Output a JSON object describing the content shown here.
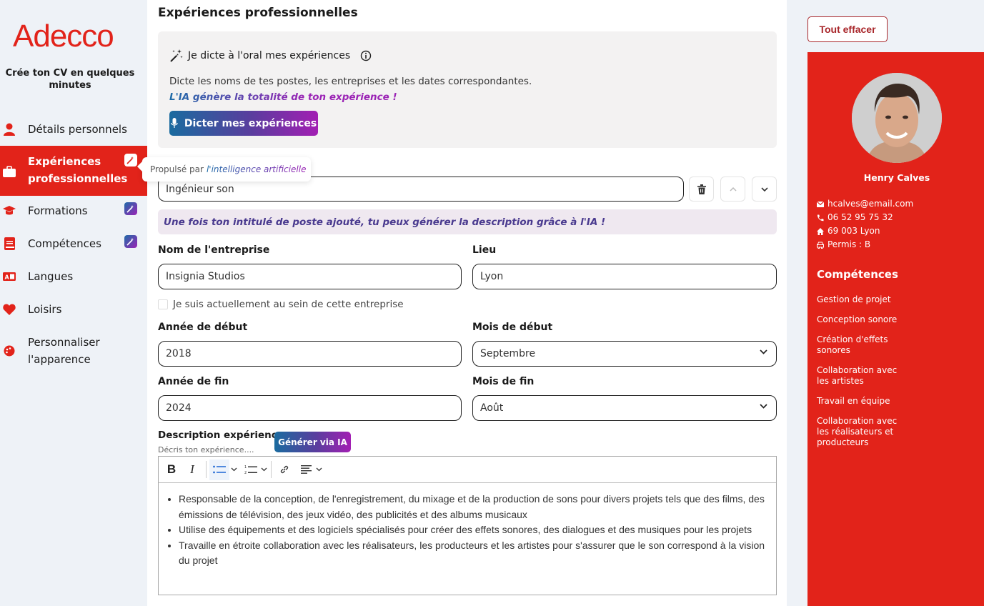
{
  "brand": {
    "logo": "Adecco",
    "tagline": "Crée ton CV en quelques minutes",
    "accent": "#e2231a"
  },
  "sidebar": {
    "items": [
      {
        "label": "Détails personnels",
        "icon": "user-icon",
        "ai": false,
        "active": false
      },
      {
        "label": "Expériences professionnelles",
        "icon": "briefcase-icon",
        "ai": true,
        "active": true
      },
      {
        "label": "Formations",
        "icon": "graduation-cap-icon",
        "ai": true,
        "active": false
      },
      {
        "label": "Compétences",
        "icon": "book-icon",
        "ai": true,
        "active": false
      },
      {
        "label": "Langues",
        "icon": "language-icon",
        "ai": false,
        "active": false
      },
      {
        "label": "Loisirs",
        "icon": "heart-icon",
        "ai": false,
        "active": false
      },
      {
        "label": "Personnaliser l'apparence",
        "icon": "palette-icon",
        "ai": false,
        "active": false
      }
    ]
  },
  "tooltip": {
    "prefix": "Propulsé par",
    "highlight": "l'intelligence artificielle"
  },
  "main": {
    "title": "Expériences professionnelles",
    "dictate": {
      "heading": "Je dicte à l'oral mes expériences",
      "description": "Dicte les noms de tes postes, les entreprises et les dates correspondantes.",
      "ai_line": "L'IA génère la totalité de ton expérience !",
      "button": "Dicter mes expériences"
    },
    "job_title": {
      "value": "Ingénieur son"
    },
    "ai_hint": "Une fois ton intitulé de poste ajouté, tu peux générer la description grâce à l'IA !",
    "company": {
      "label": "Nom de l'entreprise",
      "value": "Insignia Studios"
    },
    "location": {
      "label": "Lieu",
      "value": "Lyon"
    },
    "current_checkbox": {
      "label": "Je suis actuellement au sein de cette entreprise",
      "checked": false
    },
    "start_year": {
      "label": "Année de début",
      "value": "2018"
    },
    "start_month": {
      "label": "Mois de début",
      "value": "Septembre"
    },
    "end_year": {
      "label": "Année de fin",
      "value": "2024"
    },
    "end_month": {
      "label": "Mois de fin",
      "value": "Août"
    },
    "description": {
      "label": "Description expérience",
      "placeholder": "Décris ton expérience....",
      "generate_button": "Générer via IA",
      "toolbar": {
        "bold": "B",
        "italic": "I"
      },
      "bullets": [
        "Responsable de la conception, de l'enregistrement, du mixage et de la production de sons pour divers projets tels que des films, des émissions de télévision, des jeux vidéo, des publicités et des albums musicaux",
        "Utilise des équipements et des logiciels spécialisés pour créer des effets sonores, des dialogues et des musiques pour les projets",
        "Travaille en étroite collaboration avec les réalisateurs, les producteurs et les artistes pour s'assurer que le son correspond à la vision du projet"
      ]
    }
  },
  "preview": {
    "clear_button": "Tout effacer",
    "name": "Henry Calves",
    "email": "hcalves@email.com",
    "phone": "06 52 95 75 32",
    "address": "69 003 Lyon",
    "license": "Permis : B",
    "skills_title": "Compétences",
    "skills": [
      "Gestion de projet",
      "Conception sonore",
      "Création d'effets sonores",
      "Collaboration avec les artistes",
      "Travail en équipe",
      "Collaboration avec les réalisateurs et producteurs"
    ]
  }
}
